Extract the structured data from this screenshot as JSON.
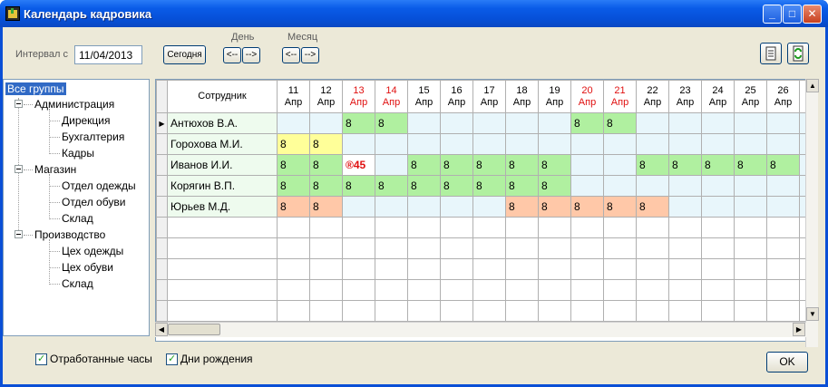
{
  "window": {
    "title": "Календарь кадровика"
  },
  "toolbar": {
    "interval_label": "Интервал с",
    "interval_value": "11/04/2013",
    "today_button": "Сегодня",
    "day_label": "День",
    "month_label": "Месяц",
    "prev_arrow": "<--",
    "next_arrow": "-->"
  },
  "tree": {
    "root": "Все группы",
    "groups": [
      {
        "label": "Администрация",
        "children": [
          "Дирекция",
          "Бухгалтерия",
          "Кадры"
        ]
      },
      {
        "label": "Магазин",
        "children": [
          "Отдел одежды",
          "Отдел обуви",
          "Склад"
        ]
      },
      {
        "label": "Производство",
        "children": [
          "Цех одежды",
          "Цех обуви",
          "Склад"
        ]
      }
    ]
  },
  "grid": {
    "employee_header": "Сотрудник",
    "month_abbr": "Апр",
    "days": [
      {
        "num": "11",
        "weekend": false
      },
      {
        "num": "12",
        "weekend": false
      },
      {
        "num": "13",
        "weekend": true
      },
      {
        "num": "14",
        "weekend": true
      },
      {
        "num": "15",
        "weekend": false
      },
      {
        "num": "16",
        "weekend": false
      },
      {
        "num": "17",
        "weekend": false
      },
      {
        "num": "18",
        "weekend": false
      },
      {
        "num": "19",
        "weekend": false
      },
      {
        "num": "20",
        "weekend": true
      },
      {
        "num": "21",
        "weekend": true
      },
      {
        "num": "22",
        "weekend": false
      },
      {
        "num": "23",
        "weekend": false
      },
      {
        "num": "24",
        "weekend": false
      },
      {
        "num": "25",
        "weekend": false
      },
      {
        "num": "26",
        "weekend": false
      }
    ],
    "rows": [
      {
        "name": "Антюхов В.А.",
        "current": true,
        "color": "#b0f0a0",
        "cells": [
          "",
          "",
          "8",
          "8",
          "",
          "",
          "",
          "",
          "",
          "8",
          "8",
          "",
          "",
          "",
          "",
          ""
        ]
      },
      {
        "name": "Горохова М.И.",
        "current": false,
        "color": "#ffff99",
        "cells": [
          "8",
          "8",
          "",
          "",
          "",
          "",
          "",
          "",
          "",
          "",
          "",
          "",
          "",
          "",
          "",
          ""
        ]
      },
      {
        "name": "Иванов И.И.",
        "current": false,
        "color": "#b0f0a0",
        "cells": [
          "8",
          "8",
          "®45",
          "",
          "8",
          "8",
          "8",
          "8",
          "8",
          "",
          "",
          "8",
          "8",
          "8",
          "8",
          "8"
        ]
      },
      {
        "name": "Корягин В.П.",
        "current": false,
        "color": "#b0f0a0",
        "cells": [
          "8",
          "8",
          "8",
          "8",
          "8",
          "8",
          "8",
          "8",
          "8",
          "",
          "",
          "",
          "",
          "",
          "",
          ""
        ]
      },
      {
        "name": "Юрьев М.Д.",
        "current": false,
        "color": "#ffc8a8",
        "cells": [
          "8",
          "8",
          "",
          "",
          "",
          "",
          "",
          "8",
          "8",
          "8",
          "8",
          "8",
          "",
          "",
          "",
          ""
        ]
      }
    ],
    "empty_rows": 5
  },
  "footer": {
    "worked_hours": "Отработанные часы",
    "birthdays": "Дни рождения",
    "ok": "OK"
  },
  "icons": [
    "window-app-icon",
    "minimize-icon",
    "maximize-icon",
    "close-icon",
    "print-icon",
    "refresh-icon"
  ]
}
